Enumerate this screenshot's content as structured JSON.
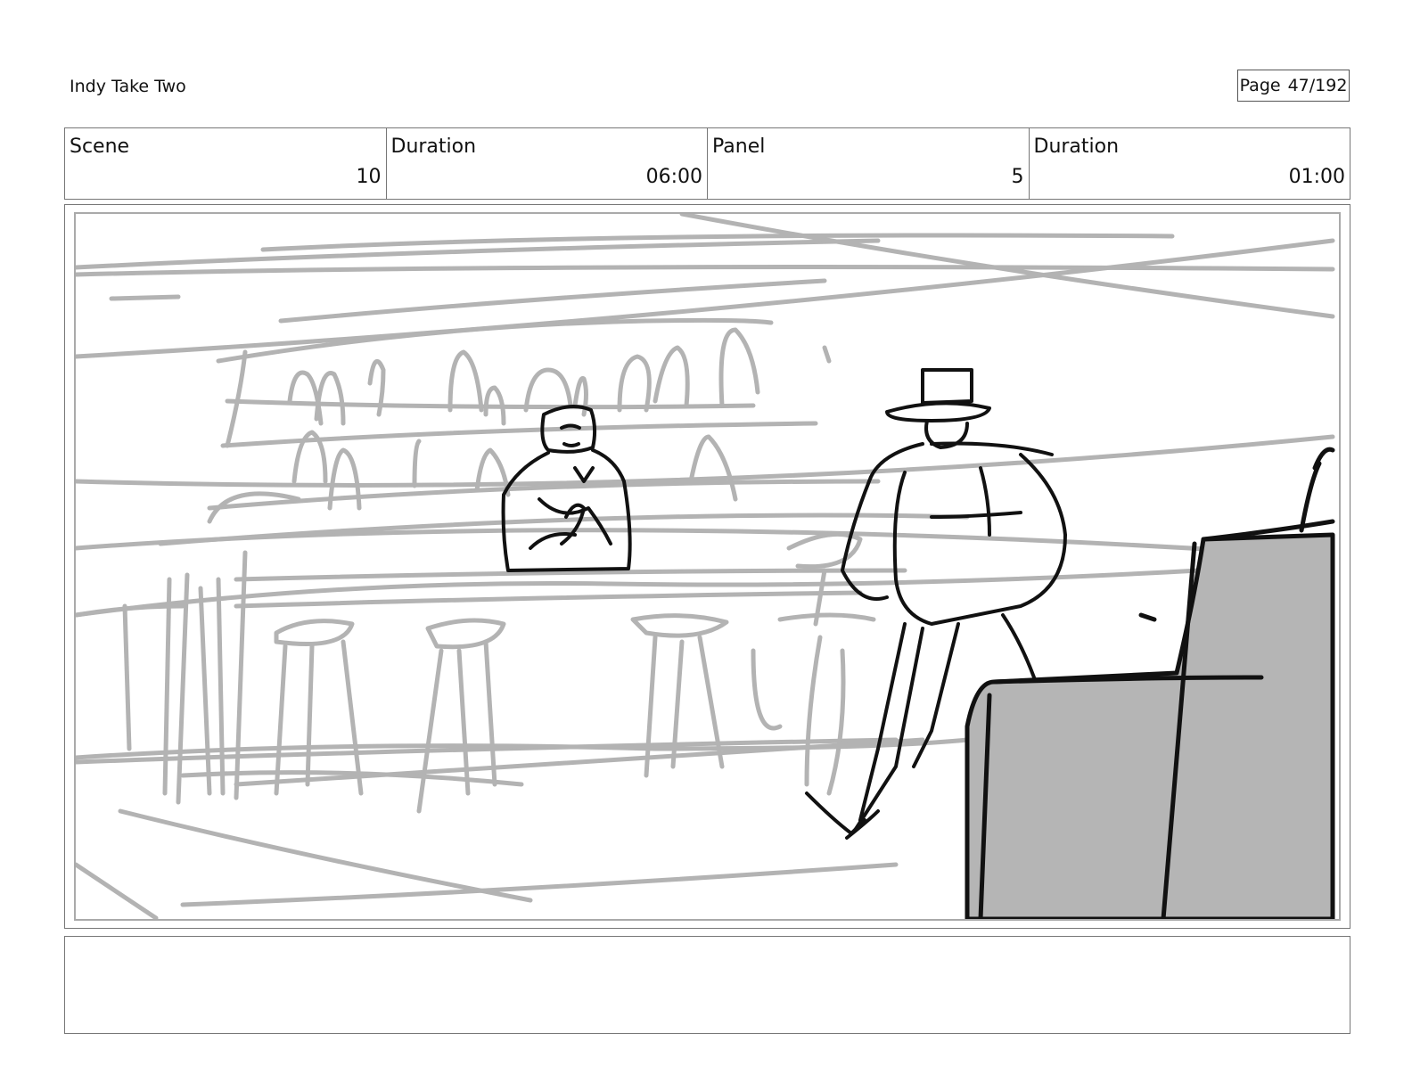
{
  "header": {
    "title": "Indy Take Two",
    "page_label": "Page",
    "page_number": "47/192"
  },
  "info": {
    "scene_label": "Scene",
    "scene_value": "10",
    "scene_duration_label": "Duration",
    "scene_duration_value": "06:00",
    "panel_label": "Panel",
    "panel_value": "5",
    "panel_duration_label": "Duration",
    "panel_duration_value": "01:00"
  },
  "notes": {
    "text": ""
  }
}
